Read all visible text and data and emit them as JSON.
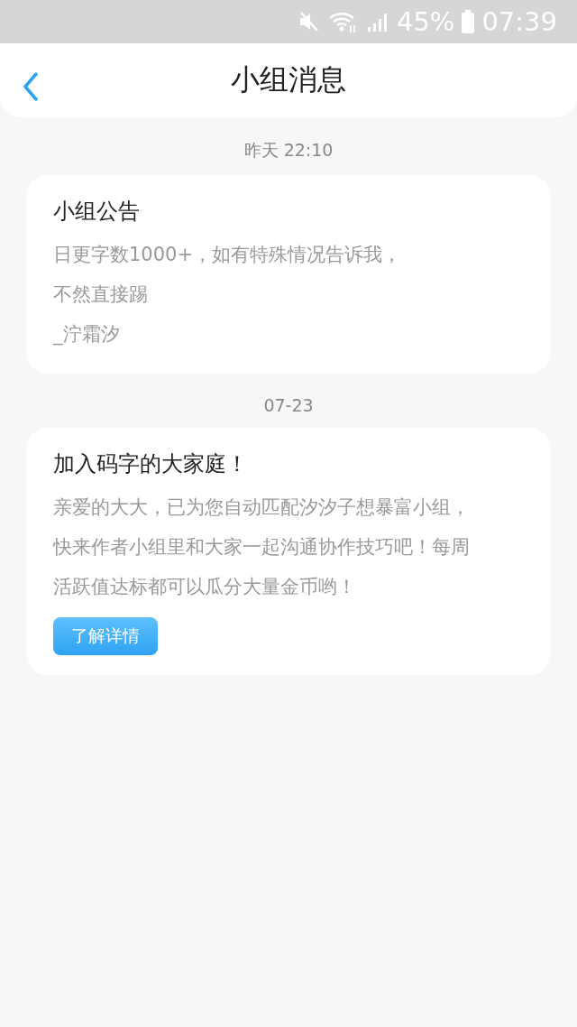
{
  "status_bar": {
    "battery": "45%",
    "time": "07:39"
  },
  "header": {
    "title": "小组消息"
  },
  "messages": [
    {
      "timestamp": "昨天 22:10",
      "title": "小组公告",
      "lines": [
        "日更字数1000+，如有特殊情况告诉我，",
        "不然直接踢",
        "_泞霜汐"
      ]
    },
    {
      "timestamp": "07-23",
      "title": "加入码字的大家庭！",
      "lines": [
        "亲爱的大大，已为您自动匹配汐汐子想暴富小组，",
        "快来作者小组里和大家一起沟通协作技巧吧！每周",
        "活跃值达标都可以瓜分大量金币哟！"
      ],
      "button": "了解详情"
    }
  ]
}
